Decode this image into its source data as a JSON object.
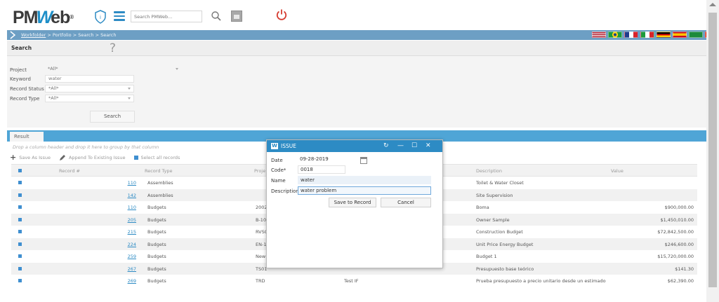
{
  "app": {
    "logo_pre": "PM",
    "logo_w": "W",
    "logo_post": "eb",
    "logo_reg": "®"
  },
  "header": {
    "search_placeholder": "Search PMWeb..."
  },
  "breadcrumb": {
    "workfolder": "Workfolder",
    "rest": " > Portfolio > Search > Search"
  },
  "colors": {
    "accent": "#2d8bc4",
    "breadcrumb_bg": "#6d9fc4",
    "result_bar": "#4fa5d6"
  },
  "search": {
    "title": "Search",
    "help_glyph": "?",
    "fields": [
      {
        "label": "Project",
        "value": "*All*",
        "dropdown": true
      },
      {
        "label": "Keyword",
        "value": "water",
        "dropdown": false
      },
      {
        "label": "Record Status",
        "value": "*All*",
        "dropdown": true
      },
      {
        "label": "Record Type",
        "value": "*All*",
        "dropdown": true
      }
    ],
    "button": "Search"
  },
  "result": {
    "tab": "Result",
    "group_hint": "Drop a column header and drop it here to group by that column",
    "toolbar": {
      "save_as_issue": "Save As Issue",
      "append_to_issue": "Append To Existing Issue",
      "select_all": "Select all records"
    },
    "columns": [
      "Record #",
      "Record Type",
      "Proje",
      "Description",
      "Value"
    ],
    "rows": [
      {
        "record": "110",
        "type": "Assemblies",
        "project": "",
        "description": "Toilet & Water Closet",
        "value": "",
        "col4": ""
      },
      {
        "record": "142",
        "type": "Assemblies",
        "project": "",
        "description": "Site Supervision",
        "value": "",
        "col4": ""
      },
      {
        "record": "110",
        "type": "Budgets",
        "project": "2002",
        "description": "Boma",
        "value": "$900,000.00",
        "col4": ""
      },
      {
        "record": "205",
        "type": "Budgets",
        "project": "B-10",
        "description": "Owner Sample",
        "value": "$1,450,010.00",
        "col4": ""
      },
      {
        "record": "215",
        "type": "Budgets",
        "project": "RVSC",
        "description": "Construction Budget",
        "value": "$72,842,500.00",
        "col4": ""
      },
      {
        "record": "224",
        "type": "Budgets",
        "project": "EN-1",
        "description": "Unit Price Energy Budget",
        "value": "$246,600.00",
        "col4": ""
      },
      {
        "record": "259",
        "type": "Budgets",
        "project": "New",
        "description": "Budget 1",
        "value": "$15,720,000.00",
        "col4": ""
      },
      {
        "record": "267",
        "type": "Budgets",
        "project": "TS01",
        "description": "Presupuesto base teórico",
        "value": "$141.30",
        "col4": ""
      },
      {
        "record": "269",
        "type": "Budgets",
        "project": "TRD",
        "description": "Prueba presupuesto a precio unitario desde un estimado",
        "value": "$62,390.00",
        "col4": "Test IF"
      }
    ]
  },
  "dialog": {
    "title": "ISSUE",
    "logo_glyph": "W",
    "controls": {
      "refresh": "↻",
      "minimize": "—",
      "maximize": "☐",
      "close": "✕"
    },
    "fields": [
      {
        "label": "Date",
        "value": "09-28-2019"
      },
      {
        "label": "Code*",
        "value": "0018"
      },
      {
        "label": "Name",
        "value": "water"
      },
      {
        "label": "Description",
        "value": "water problem"
      }
    ],
    "save_button": "Save to Record",
    "cancel_button": "Cancel"
  }
}
